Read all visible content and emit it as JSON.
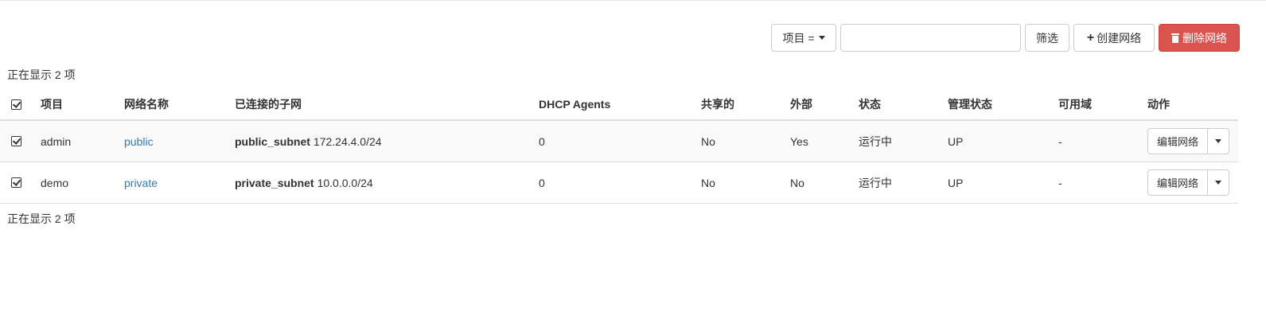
{
  "toolbar": {
    "project_select_label": "项目 =",
    "filter_input_value": "",
    "filter_label": "筛选",
    "create_label": "创建网络",
    "delete_label": "删除网络",
    "delete_color": "#d9534f",
    "create_icon": "plus-icon",
    "delete_icon": "trash-icon"
  },
  "summary": {
    "top": "正在显示 2 项",
    "bottom": "正在显示 2 项"
  },
  "table": {
    "headers": {
      "project": "项目",
      "name": "网络名称",
      "subnets": "已连接的子网",
      "dhcp": "DHCP Agents",
      "shared": "共享的",
      "external": "外部",
      "status": "状态",
      "admin_state": "管理状态",
      "az": "可用域",
      "actions": "动作"
    },
    "rows": [
      {
        "project": "admin",
        "name": "public",
        "subnet_name": "public_subnet",
        "subnet_cidr": "172.24.4.0/24",
        "dhcp": "0",
        "shared": "No",
        "external": "Yes",
        "status": "运行中",
        "admin_state": "UP",
        "az": "-",
        "action_label": "编辑网络"
      },
      {
        "project": "demo",
        "name": "private",
        "subnet_name": "private_subnet",
        "subnet_cidr": "10.0.0.0/24",
        "dhcp": "0",
        "shared": "No",
        "external": "No",
        "status": "运行中",
        "admin_state": "UP",
        "az": "-",
        "action_label": "编辑网络"
      }
    ]
  },
  "colors": {
    "link": "#337ab7",
    "stripe": "#f9f9f9",
    "border": "#dddddd"
  }
}
